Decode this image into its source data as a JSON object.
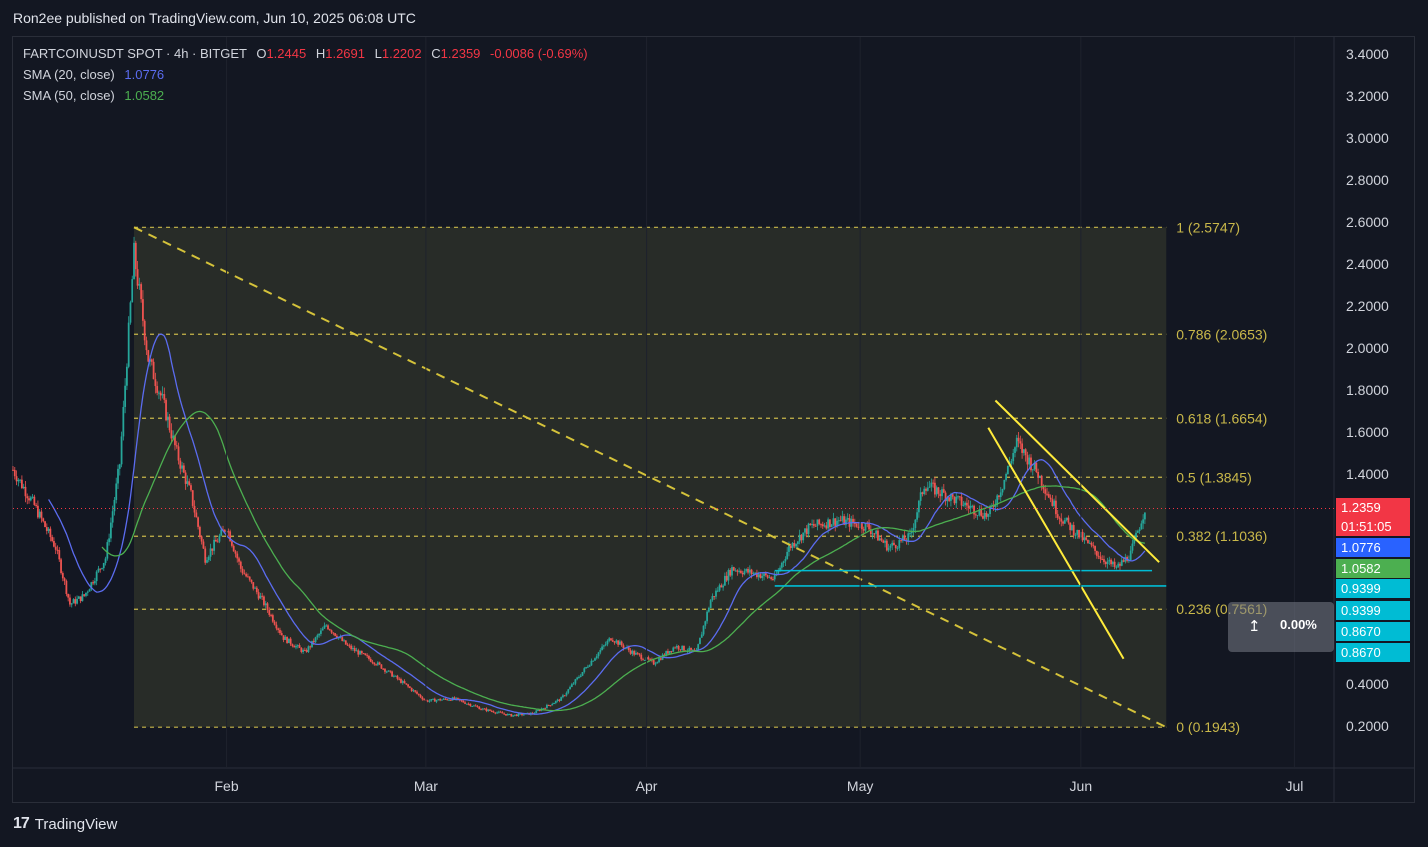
{
  "header": {
    "published_by": "Ron2ee published on TradingView.com, Jun 10, 2025 06:08 UTC"
  },
  "legend": {
    "symbol": "FARTCOINUSDT SPOT · 4h · BITGET",
    "o_label": "O",
    "o_value": "1.2445",
    "h_label": "H",
    "h_value": "1.2691",
    "l_label": "L",
    "l_value": "1.2202",
    "c_label": "C",
    "c_value": "1.2359",
    "change": "-0.0086 (-0.69%)",
    "sma20_label": "SMA (20, close)",
    "sma20_value": "1.0776",
    "sma50_label": "SMA (50, close)",
    "sma50_value": "1.0582"
  },
  "footer": {
    "brand": "TradingView"
  },
  "measure": {
    "icon": "vertical-measure-icon",
    "percent": "0.00%"
  },
  "price_tags": [
    {
      "label": "1.2359",
      "sub": "01:51:05",
      "color": "#f23645"
    },
    {
      "label": "1.0776",
      "color": "#2962ff"
    },
    {
      "label": "1.0582",
      "color": "#4caf50"
    },
    {
      "label": "0.9399",
      "color": "#00bcd4"
    },
    {
      "label": "0.9399",
      "color": "#00bcd4"
    },
    {
      "label": "0.8670",
      "color": "#00bcd4"
    },
    {
      "label": "0.8670",
      "color": "#00bcd4"
    }
  ],
  "chart_data": {
    "type": "candlestick",
    "y_ticks": [
      "3.4000",
      "3.2000",
      "3.0000",
      "2.8000",
      "2.6000",
      "2.4000",
      "2.2000",
      "2.0000",
      "1.8000",
      "1.6000",
      "1.4000",
      "0.4000",
      "0.2000"
    ],
    "y_tick_values": [
      3.4,
      3.2,
      3.0,
      2.8,
      2.6,
      2.4,
      2.2,
      2.0,
      1.8,
      1.6,
      1.4,
      0.4,
      0.2
    ],
    "ylim": [
      0.0,
      3.5
    ],
    "x_ticks": [
      "Feb",
      "Mar",
      "Apr",
      "May",
      "Jun",
      "Jul"
    ],
    "x_tick_dates": [
      "2025-02-01",
      "2025-03-01",
      "2025-04-01",
      "2025-05-01",
      "2025-06-01",
      "2025-07-01"
    ],
    "xlim": [
      "2025-01-02",
      "2025-07-06"
    ],
    "fib_retracement": {
      "levels": [
        {
          "ratio": "1",
          "price": 2.5747,
          "label": "1 (2.5747)"
        },
        {
          "ratio": "0.786",
          "price": 2.0653,
          "label": "0.786 (2.0653)"
        },
        {
          "ratio": "0.618",
          "price": 1.6654,
          "label": "0.618 (1.6654)"
        },
        {
          "ratio": "0.5",
          "price": 1.3845,
          "label": "0.5 (1.3845)"
        },
        {
          "ratio": "0.382",
          "price": 1.1036,
          "label": "0.382 (1.1036)"
        },
        {
          "ratio": "0.236",
          "price": 0.7561,
          "label": "0.236 (0.7561)"
        },
        {
          "ratio": "0",
          "price": 0.1943,
          "label": "0 (0.1943)"
        }
      ],
      "start_date": "2025-01-19",
      "end_date": "2025-06-13",
      "color": "#c9b84a",
      "fill": "rgba(200,200,90,0.12)"
    },
    "trendlines": [
      {
        "name": "diagonal-trend",
        "from": [
          "2025-01-19",
          2.5747
        ],
        "to": [
          "2025-06-13",
          0.1943
        ],
        "color": "#d4c23a",
        "dashed": true
      },
      {
        "name": "wedge-upper",
        "from": [
          "2025-05-20",
          1.75
        ],
        "to": [
          "2025-06-12",
          0.98
        ],
        "color": "#ffeb3b",
        "dashed": false
      },
      {
        "name": "wedge-lower",
        "from": [
          "2025-05-19",
          1.62
        ],
        "to": [
          "2025-06-07",
          0.52
        ],
        "color": "#ffeb3b",
        "dashed": false
      }
    ],
    "support_lines": [
      {
        "price": 0.9399,
        "from": "2025-04-19",
        "to": "2025-06-11",
        "color": "#00bcd4"
      },
      {
        "price": 0.867,
        "from": "2025-04-19",
        "to": "2025-06-13",
        "color": "#00bcd4"
      }
    ],
    "last_price": 1.2359,
    "price_anchors": [
      [
        "2025-01-02",
        1.42
      ],
      [
        "2025-01-05",
        1.25
      ],
      [
        "2025-01-08",
        1.05
      ],
      [
        "2025-01-10",
        0.78
      ],
      [
        "2025-01-12",
        0.82
      ],
      [
        "2025-01-15",
        1.0
      ],
      [
        "2025-01-17",
        1.45
      ],
      [
        "2025-01-19",
        2.45
      ],
      [
        "2025-01-21",
        1.95
      ],
      [
        "2025-01-23",
        1.75
      ],
      [
        "2025-01-25",
        1.5
      ],
      [
        "2025-01-27",
        1.3
      ],
      [
        "2025-01-29",
        1.0
      ],
      [
        "2025-02-01",
        1.15
      ],
      [
        "2025-02-03",
        0.95
      ],
      [
        "2025-02-06",
        0.8
      ],
      [
        "2025-02-09",
        0.62
      ],
      [
        "2025-02-12",
        0.55
      ],
      [
        "2025-02-15",
        0.68
      ],
      [
        "2025-02-18",
        0.58
      ],
      [
        "2025-02-22",
        0.5
      ],
      [
        "2025-02-26",
        0.4
      ],
      [
        "2025-03-01",
        0.32
      ],
      [
        "2025-03-05",
        0.33
      ],
      [
        "2025-03-09",
        0.28
      ],
      [
        "2025-03-13",
        0.25
      ],
      [
        "2025-03-16",
        0.26
      ],
      [
        "2025-03-20",
        0.33
      ],
      [
        "2025-03-24",
        0.5
      ],
      [
        "2025-03-27",
        0.62
      ],
      [
        "2025-03-30",
        0.55
      ],
      [
        "2025-04-02",
        0.5
      ],
      [
        "2025-04-05",
        0.58
      ],
      [
        "2025-04-08",
        0.55
      ],
      [
        "2025-04-10",
        0.8
      ],
      [
        "2025-04-13",
        0.95
      ],
      [
        "2025-04-17",
        0.92
      ],
      [
        "2025-04-19",
        0.9
      ],
      [
        "2025-04-21",
        1.05
      ],
      [
        "2025-04-24",
        1.15
      ],
      [
        "2025-04-28",
        1.18
      ],
      [
        "2025-05-02",
        1.15
      ],
      [
        "2025-05-05",
        1.05
      ],
      [
        "2025-05-08",
        1.1
      ],
      [
        "2025-05-10",
        1.35
      ],
      [
        "2025-05-13",
        1.3
      ],
      [
        "2025-05-16",
        1.25
      ],
      [
        "2025-05-19",
        1.2
      ],
      [
        "2025-05-21",
        1.35
      ],
      [
        "2025-05-23",
        1.55
      ],
      [
        "2025-05-26",
        1.4
      ],
      [
        "2025-05-29",
        1.2
      ],
      [
        "2025-06-01",
        1.1
      ],
      [
        "2025-06-04",
        1.0
      ],
      [
        "2025-06-06",
        0.95
      ],
      [
        "2025-06-08",
        1.02
      ],
      [
        "2025-06-10",
        1.2359
      ]
    ]
  }
}
